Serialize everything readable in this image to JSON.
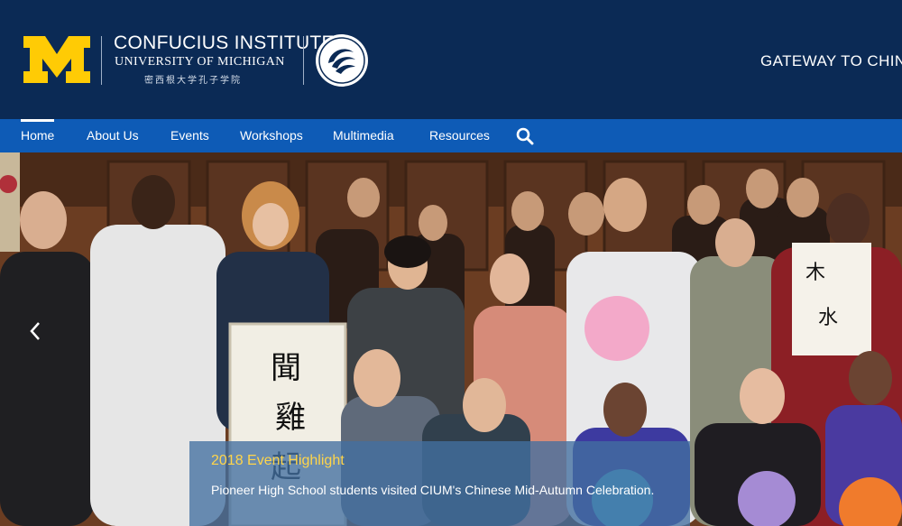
{
  "header": {
    "logo_letter": "M",
    "title": "CONFUCIUS INSTITUTE",
    "subtitle": "UNIVERSITY OF MICHIGAN",
    "chinese_name": "密西根大学孔子学院",
    "tagline": "GATEWAY TO CHINE",
    "colors": {
      "background": "#0b2a55",
      "maize": "#ffcb05"
    }
  },
  "nav": {
    "items": [
      {
        "label": "Home",
        "active": true
      },
      {
        "label": "About Us",
        "active": false
      },
      {
        "label": "Events",
        "active": false
      },
      {
        "label": "Workshops",
        "active": false
      },
      {
        "label": "Multimedia",
        "active": false
      },
      {
        "label": "Resources",
        "active": false
      }
    ],
    "search_icon": "search-icon",
    "colors": {
      "background": "#0e5bb6"
    }
  },
  "hero": {
    "prev_icon": "chevron-left-icon",
    "caption": {
      "title": "2018 Event Highlight",
      "text": "Pioneer High School students visited CIUM's Chinese Mid-Autumn Celebration."
    },
    "colors": {
      "title": "#ffd54a"
    }
  }
}
